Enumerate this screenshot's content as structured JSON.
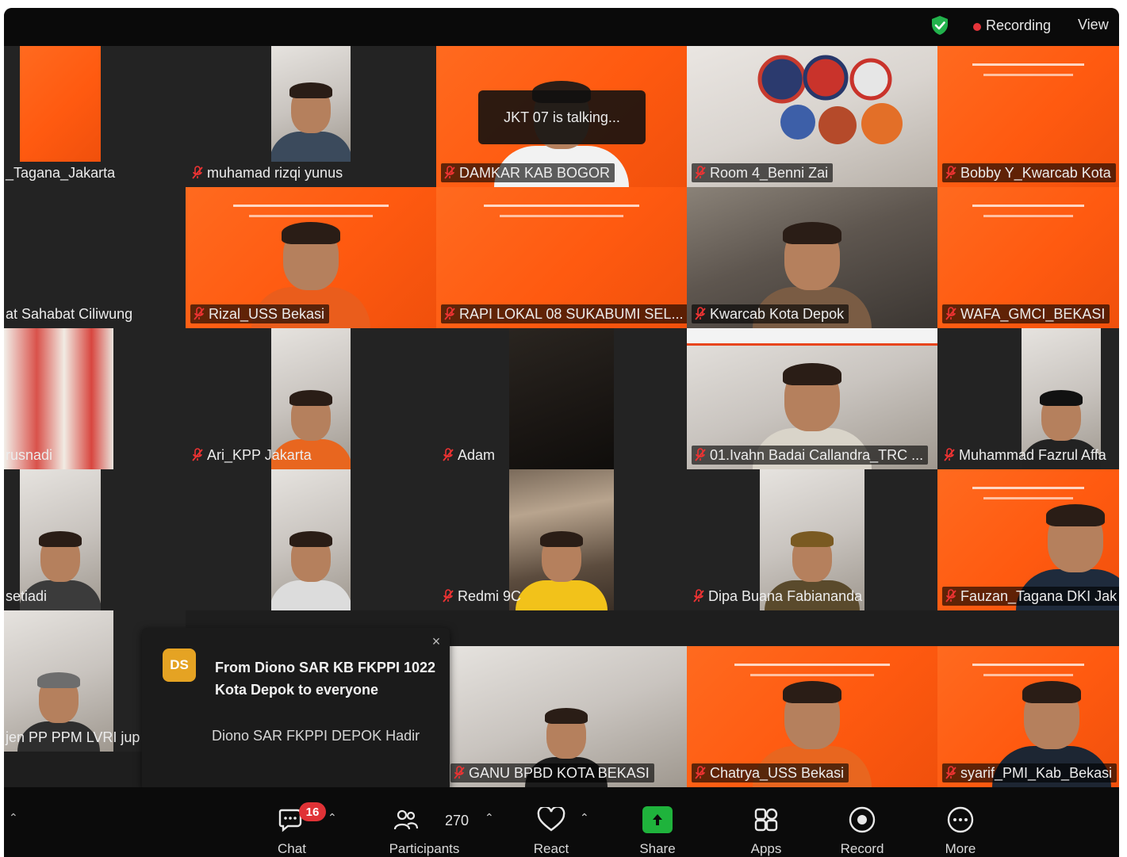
{
  "top_bar": {
    "recording_label": "Recording",
    "view_label": "View",
    "shield_icon": "shield-check-icon",
    "colors": {
      "recording_dot": "#e5343a",
      "shield": "#22b24c"
    }
  },
  "speaker_indicator": "JKT 07 is talking...",
  "participants": [
    {
      "name": "_Tagana_Jakarta"
    },
    {
      "name": "muhamad rizqi yunus"
    },
    {
      "name": "DAMKAR KAB BOGOR"
    },
    {
      "name": "Room 4_Benni Zai"
    },
    {
      "name": "Bobby Y_Kwarcab Kota"
    },
    {
      "name": "at Sahabat Ciliwung"
    },
    {
      "name": "Rizal_USS Bekasi"
    },
    {
      "name": "RAPI LOKAL 08 SUKABUMI SEL..."
    },
    {
      "name": "Kwarcab Kota Depok"
    },
    {
      "name": "WAFA_GMCI_BEKASI"
    },
    {
      "name": "rusnadi"
    },
    {
      "name": "Ari_KPP Jakarta"
    },
    {
      "name": "Adam"
    },
    {
      "name": "01.Ivahn Badai Callandra_TRC ..."
    },
    {
      "name": "Muhammad Fazrul Affa"
    },
    {
      "name": "setiadi"
    },
    {
      "name": "Redmi 9C"
    },
    {
      "name": "Dipa Buana Fabiananda"
    },
    {
      "name": "Fauzan_Tagana DKI Jak"
    },
    {
      "name": "jen PP PPM LVRI jup"
    },
    {
      "name": "GANU BPBD KOTA BEKASI"
    },
    {
      "name": "Chatrya_USS Bekasi"
    },
    {
      "name": "syarif_PMI_Kab_Bekasi"
    }
  ],
  "chat_notification": {
    "avatar_initials": "DS",
    "from": "From Diono SAR KB FKPPI 1022 Kota Depok to everyone",
    "message": "Diono SAR FKPPI DEPOK Hadir",
    "close_symbol": "×"
  },
  "toolbar": {
    "chat": {
      "label": "Chat",
      "badge": "16"
    },
    "participants": {
      "label": "Participants",
      "count": "270"
    },
    "react": {
      "label": "React"
    },
    "share": {
      "label": "Share"
    },
    "apps": {
      "label": "Apps"
    },
    "record": {
      "label": "Record"
    },
    "more": {
      "label": "More"
    },
    "colors": {
      "share": "#1fb33c",
      "badge": "#e03236"
    }
  }
}
